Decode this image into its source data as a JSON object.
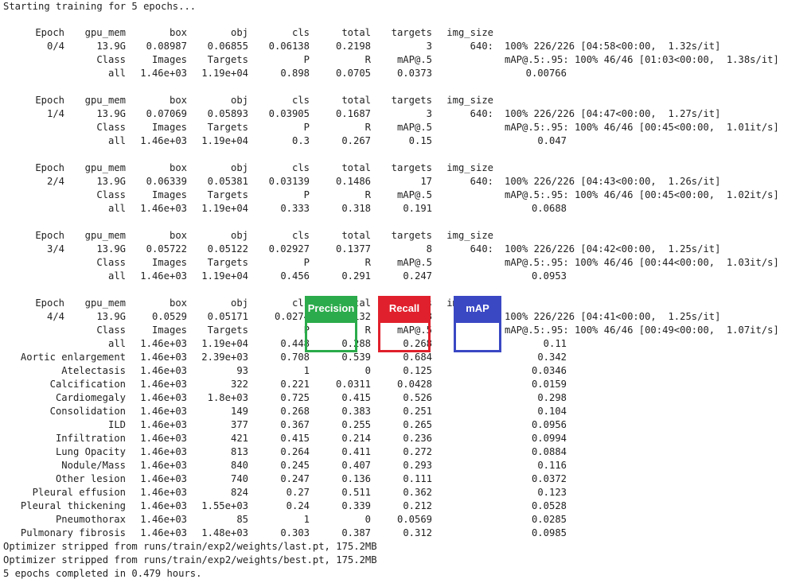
{
  "intro": "Starting training for 5 epochs...",
  "hdr": [
    "Epoch",
    "gpu_mem",
    "box",
    "obj",
    "cls",
    "total",
    "targets",
    "img_size"
  ],
  "vhdr": [
    "Class",
    "Images",
    "Targets",
    "P",
    "R",
    "mAP@.5",
    "mAP@.5:.95:"
  ],
  "epochs": [
    {
      "row": [
        "0/4",
        "13.9G",
        "0.08987",
        "0.06855",
        "0.06138",
        "0.2198",
        "3",
        "640:"
      ],
      "prog": "100% 226/226 [04:58<00:00,  1.32s/it]",
      "vprog": "100% 46/46 [01:03<00:00,  1.38s/it]",
      "all": [
        "all",
        "1.46e+03",
        "1.19e+04",
        "0.898",
        "0.0705",
        "0.0373",
        "0.00766"
      ]
    },
    {
      "row": [
        "1/4",
        "13.9G",
        "0.07069",
        "0.05893",
        "0.03905",
        "0.1687",
        "3",
        "640:"
      ],
      "prog": "100% 226/226 [04:47<00:00,  1.27s/it]",
      "vprog": "100% 46/46 [00:45<00:00,  1.01it/s]",
      "all": [
        "all",
        "1.46e+03",
        "1.19e+04",
        "0.3",
        "0.267",
        "0.15",
        "0.047"
      ]
    },
    {
      "row": [
        "2/4",
        "13.9G",
        "0.06339",
        "0.05381",
        "0.03139",
        "0.1486",
        "17",
        "640:"
      ],
      "prog": "100% 226/226 [04:43<00:00,  1.26s/it]",
      "vprog": "100% 46/46 [00:45<00:00,  1.02it/s]",
      "all": [
        "all",
        "1.46e+03",
        "1.19e+04",
        "0.333",
        "0.318",
        "0.191",
        "0.0688"
      ]
    },
    {
      "row": [
        "3/4",
        "13.9G",
        "0.05722",
        "0.05122",
        "0.02927",
        "0.1377",
        "8",
        "640:"
      ],
      "prog": "100% 226/226 [04:42<00:00,  1.25s/it]",
      "vprog": "100% 46/46 [00:44<00:00,  1.03it/s]",
      "all": [
        "all",
        "1.46e+03",
        "1.19e+04",
        "0.456",
        "0.291",
        "0.247",
        "0.0953"
      ]
    },
    {
      "row": [
        "4/4",
        "13.9G",
        "0.0529",
        "0.05171",
        "0.0274",
        "0.132",
        "8",
        "640:"
      ],
      "prog": "100% 226/226 [04:41<00:00,  1.25s/it]",
      "vprog": "100% 46/46 [00:49<00:00,  1.07it/s]",
      "all": [
        "all",
        "1.46e+03",
        "1.19e+04",
        "0.448",
        "0.288",
        "0.268",
        "0.11"
      ]
    }
  ],
  "classes": [
    [
      "Aortic enlargement",
      "1.46e+03",
      "2.39e+03",
      "0.708",
      "0.539",
      "0.684",
      "0.342"
    ],
    [
      "Atelectasis",
      "1.46e+03",
      "93",
      "1",
      "0",
      "0.125",
      "0.0346"
    ],
    [
      "Calcification",
      "1.46e+03",
      "322",
      "0.221",
      "0.0311",
      "0.0428",
      "0.0159"
    ],
    [
      "Cardiomegaly",
      "1.46e+03",
      "1.8e+03",
      "0.725",
      "0.415",
      "0.526",
      "0.298"
    ],
    [
      "Consolidation",
      "1.46e+03",
      "149",
      "0.268",
      "0.383",
      "0.251",
      "0.104"
    ],
    [
      "ILD",
      "1.46e+03",
      "377",
      "0.367",
      "0.255",
      "0.265",
      "0.0956"
    ],
    [
      "Infiltration",
      "1.46e+03",
      "421",
      "0.415",
      "0.214",
      "0.236",
      "0.0994"
    ],
    [
      "Lung Opacity",
      "1.46e+03",
      "813",
      "0.264",
      "0.411",
      "0.272",
      "0.0884"
    ],
    [
      "Nodule/Mass",
      "1.46e+03",
      "840",
      "0.245",
      "0.407",
      "0.293",
      "0.116"
    ],
    [
      "Other lesion",
      "1.46e+03",
      "740",
      "0.247",
      "0.136",
      "0.111",
      "0.0372"
    ],
    [
      "Pleural effusion",
      "1.46e+03",
      "824",
      "0.27",
      "0.511",
      "0.362",
      "0.123"
    ],
    [
      "Pleural thickening",
      "1.46e+03",
      "1.55e+03",
      "0.24",
      "0.339",
      "0.212",
      "0.0528"
    ],
    [
      "Pneumothorax",
      "1.46e+03",
      "85",
      "1",
      "0",
      "0.0569",
      "0.0285"
    ],
    [
      "Pulmonary fibrosis",
      "1.46e+03",
      "1.48e+03",
      "0.303",
      "0.387",
      "0.312",
      "0.0985"
    ]
  ],
  "footer": [
    "Optimizer stripped from runs/train/exp2/weights/last.pt, 175.2MB",
    "Optimizer stripped from runs/train/exp2/weights/best.pt, 175.2MB",
    "5 epochs completed in 0.479 hours."
  ],
  "highlights": [
    {
      "label": "Precision",
      "color": "#2bab4b"
    },
    {
      "label": "Recall",
      "color": "#e0202c"
    },
    {
      "label": "mAP",
      "color": "#3a48c4"
    }
  ]
}
